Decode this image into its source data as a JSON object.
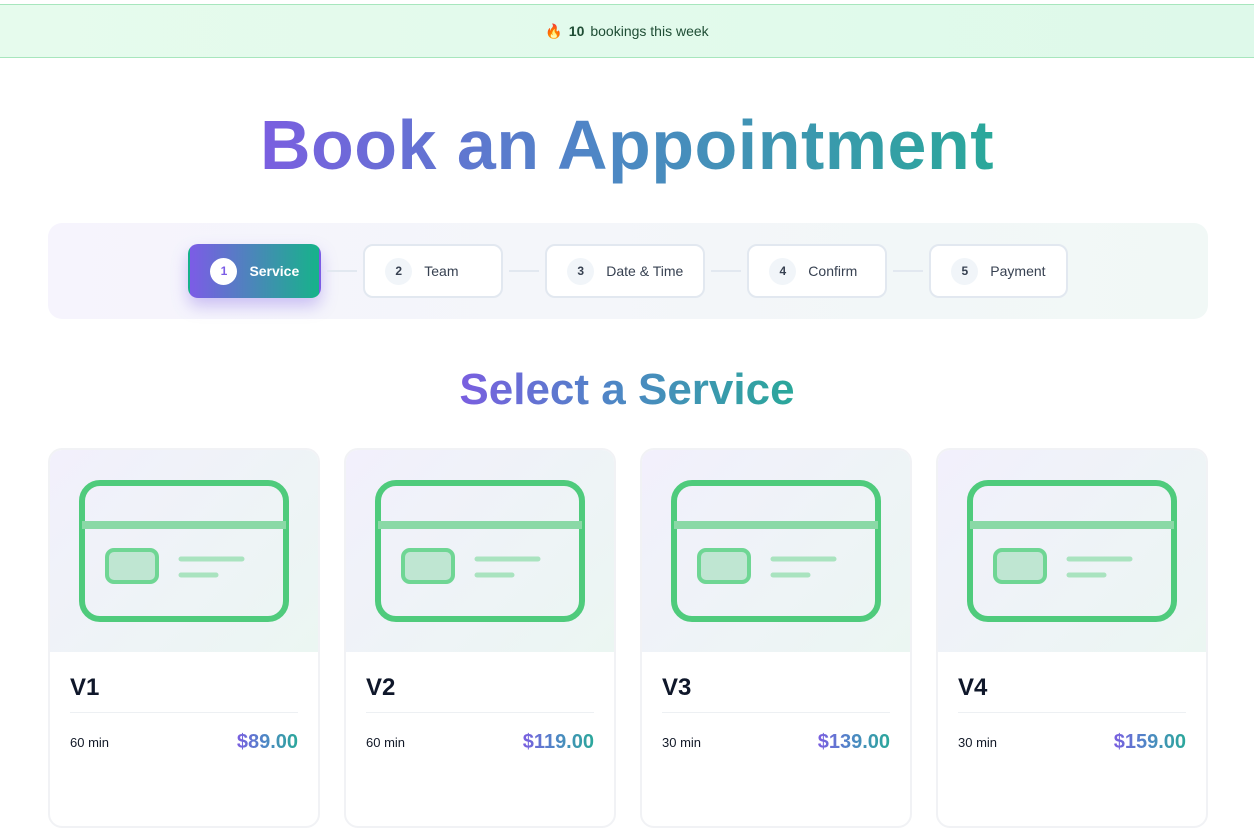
{
  "banner": {
    "icon": "fire-icon",
    "count": "10",
    "text": "bookings this week"
  },
  "title": "Book an Appointment",
  "steps": [
    {
      "number": "1",
      "label": "Service",
      "active": true
    },
    {
      "number": "2",
      "label": "Team",
      "active": false
    },
    {
      "number": "3",
      "label": "Date & Time",
      "active": false
    },
    {
      "number": "4",
      "label": "Confirm",
      "active": false
    },
    {
      "number": "5",
      "label": "Payment",
      "active": false
    }
  ],
  "section_title": "Select a Service",
  "services": [
    {
      "name": "V1",
      "duration": "60 min",
      "price": "$89.00",
      "icon": "credit-card-icon"
    },
    {
      "name": "V2",
      "duration": "60 min",
      "price": "$119.00",
      "icon": "credit-card-icon"
    },
    {
      "name": "V3",
      "duration": "30 min",
      "price": "$139.00",
      "icon": "credit-card-icon"
    },
    {
      "name": "V4",
      "duration": "30 min",
      "price": "$159.00",
      "icon": "credit-card-icon"
    }
  ],
  "colors": {
    "gradient_start": "#7a5ee0",
    "gradient_end": "#2aa89a",
    "card_icon": "#4fcb7c",
    "banner_bg": "#e6fbed"
  }
}
